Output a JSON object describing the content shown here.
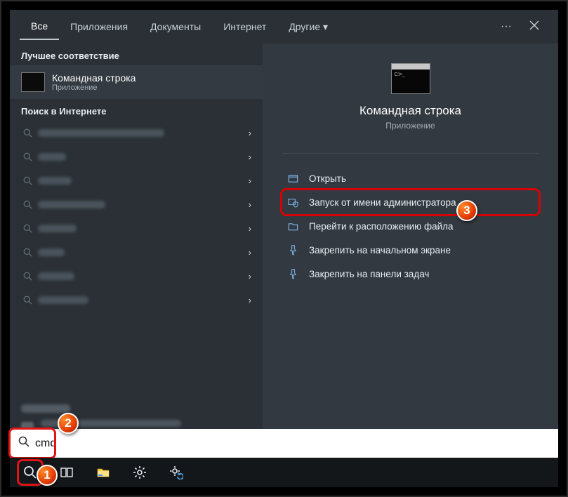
{
  "tabs": {
    "all": "Все",
    "apps": "Приложения",
    "docs": "Документы",
    "internet": "Интернет",
    "more": "Другие"
  },
  "sections": {
    "best": "Лучшее соответствие",
    "web": "Поиск в Интернете"
  },
  "bestMatch": {
    "title": "Командная строка",
    "subtitle": "Приложение"
  },
  "hero": {
    "title": "Командная строка",
    "subtitle": "Приложение"
  },
  "actions": {
    "open": "Открыть",
    "admin": "Запуск от имени администратора",
    "location": "Перейти к расположению файла",
    "pinStart": "Закрепить на начальном экране",
    "pinTask": "Закрепить на панели задач"
  },
  "search": {
    "value": "cmd"
  },
  "markers": {
    "one": "1",
    "two": "2",
    "three": "3"
  }
}
